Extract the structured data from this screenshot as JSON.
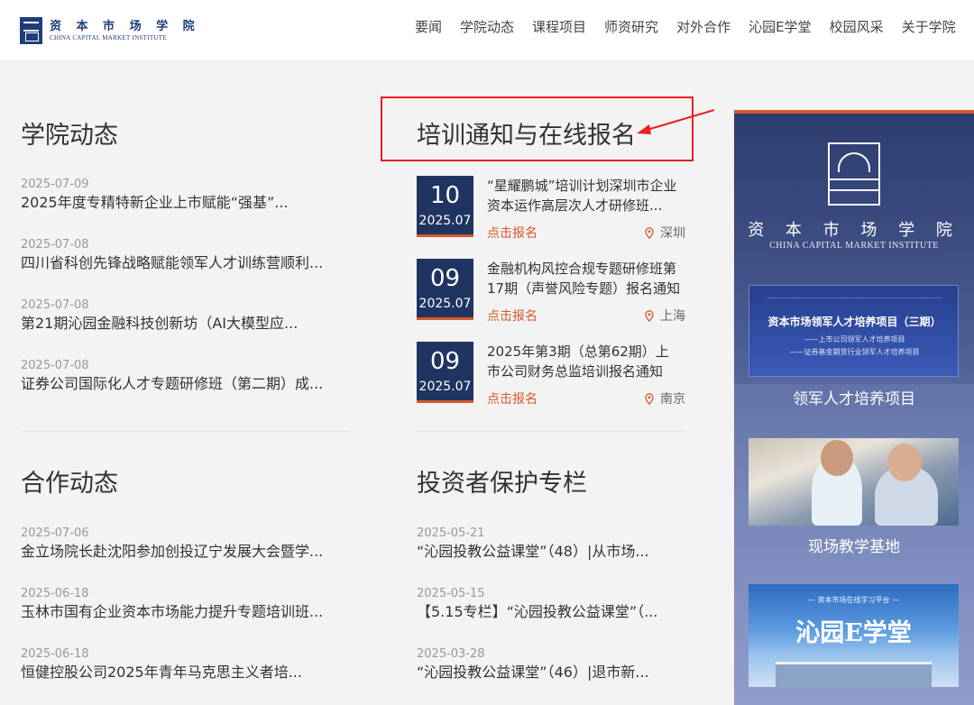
{
  "header": {
    "logo_cn": "资 本 市 场 学 院",
    "logo_en": "CHINA CAPITAL MARKET INSTITUTE",
    "nav": [
      "要闻",
      "学院动态",
      "课程项目",
      "师资研究",
      "对外合作",
      "沁园E学堂",
      "校园风采",
      "关于学院"
    ]
  },
  "college_news": {
    "title": "学院动态",
    "items": [
      {
        "date": "2025-07-09",
        "title": "2025年度专精特新企业上市赋能“强基”..."
      },
      {
        "date": "2025-07-08",
        "title": "四川省科创先锋战略赋能领军人才训练营顺利..."
      },
      {
        "date": "2025-07-08",
        "title": "第21期沁园金融科技创新坊（AI大模型应..."
      },
      {
        "date": "2025-07-08",
        "title": "证券公司国际化人才专题研修班（第二期）成..."
      }
    ]
  },
  "training": {
    "title": "培训通知与在线报名",
    "signup_label": "点击报名",
    "items": [
      {
        "day": "10",
        "ym": "2025.07",
        "title": "“星耀鹏城”培训计划深圳市企业资本运作高层次人才研修班...",
        "location": "深圳"
      },
      {
        "day": "09",
        "ym": "2025.07",
        "title": "金融机构风控合规专题研修班第17期（声誉风险专题）报名通知",
        "location": "上海"
      },
      {
        "day": "09",
        "ym": "2025.07",
        "title": "2025年第3期（总第62期）上市公司财务总监培训报名通知",
        "location": "南京"
      }
    ]
  },
  "cooperation": {
    "title": "合作动态",
    "items": [
      {
        "date": "2025-07-06",
        "title": "金立场院长赴沈阳参加创投辽宁发展大会暨学..."
      },
      {
        "date": "2025-06-18",
        "title": "玉林市国有企业资本市场能力提升专题培训班..."
      },
      {
        "date": "2025-06-18",
        "title": "恒健控股公司2025年青年马克思主义者培..."
      }
    ]
  },
  "investor": {
    "title": "投资者保护专栏",
    "items": [
      {
        "date": "2025-05-21",
        "title": "“沁园投教公益课堂”（48）|从市场..."
      },
      {
        "date": "2025-05-15",
        "title": "【5.15专栏】“沁园投教公益课堂”（..."
      },
      {
        "date": "2025-03-28",
        "title": "“沁园投教公益课堂”（46）|退市新..."
      }
    ]
  },
  "sidebar": {
    "logo_cn": "资 本 市 场 学 院",
    "logo_en": "CHINA CAPITAL MARKET INSTITUTE",
    "banner1_head": "资本市场领军人才培养项目（三期）",
    "banner1_sub1": "——上市公司领军人才培养项目",
    "banner1_sub2": "——证券基金期货行业领军人才培养项目",
    "caption1": "领军人才培养项目",
    "caption2": "现场教学基地",
    "banner3_sub": "— 资本市场在线学习平台 —",
    "banner3_head": "沁园E学堂"
  },
  "colors": {
    "accent": "#d8582b",
    "navy": "#1f3461",
    "annotation": "#e8201f"
  }
}
